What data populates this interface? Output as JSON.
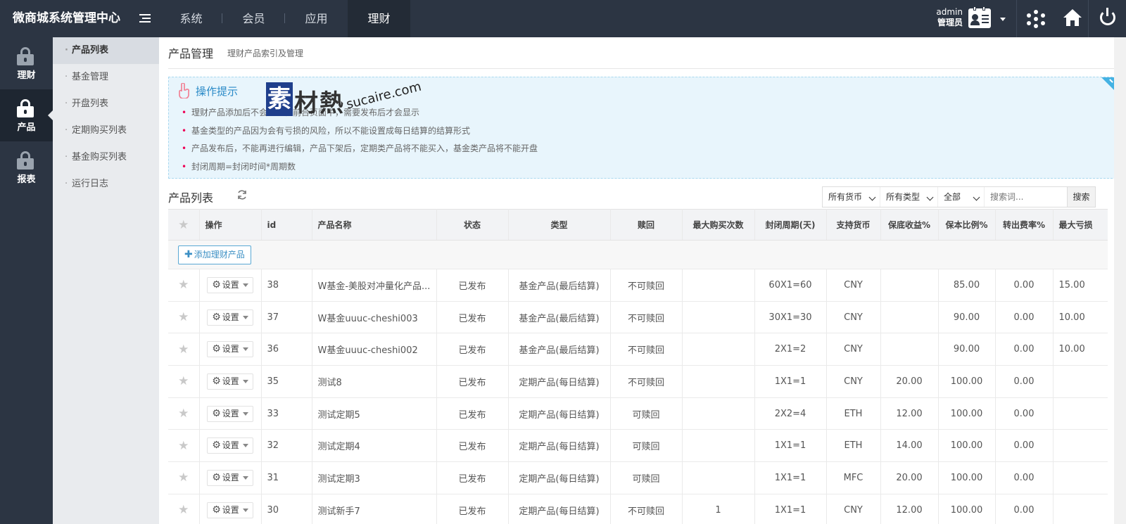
{
  "app": {
    "title": "微商城系统管理中心"
  },
  "topnav": [
    "系统",
    "会员",
    "应用",
    "理财"
  ],
  "user": {
    "name": "admin",
    "role": "管理员"
  },
  "sidebar": [
    {
      "label": "理财"
    },
    {
      "label": "产品"
    },
    {
      "label": "报表"
    }
  ],
  "submenu": [
    "产品列表",
    "基金管理",
    "开盘列表",
    "定期购买列表",
    "基金购买列表",
    "运行日志"
  ],
  "page": {
    "title": "产品管理",
    "subtitle": "理财产品索引及管理"
  },
  "tips": {
    "title": "操作提示",
    "items": [
      "理财产品添加后不会显示在前台页面中，需要发布后才会显示",
      "基金类型的产品因为会有亏损的风险，所以不能设置成每日结算的结算形式",
      "产品发布后，不能再进行编辑，产品下架后，定期类产品将不能买入，基金类产品将不能开盘",
      "封闭周期=封闭时间*周期数"
    ]
  },
  "watermark": {
    "box": "素",
    "text": "材熱",
    "url": "sucaire.com"
  },
  "list": {
    "title": "产品列表",
    "filters": [
      "所有货币",
      "所有类型",
      "全部"
    ],
    "search_placeholder": "搜索词...",
    "search_label": "搜索",
    "add_label": "添加理财产品",
    "set_label": "设置"
  },
  "table": {
    "columns": [
      "操作",
      "id",
      "产品名称",
      "状态",
      "类型",
      "赎回",
      "最大购买次数",
      "封闭周期(天)",
      "支持货币",
      "保底收益%",
      "保本比例%",
      "转出费率%",
      "最大亏损"
    ],
    "rows": [
      [
        "38",
        "W基金-美股对冲量化产品...",
        "已发布",
        "基金产品(最后结算)",
        "不可赎回",
        "",
        "60X1=60",
        "CNY",
        "",
        "85.00",
        "0.00",
        "15.00"
      ],
      [
        "37",
        "W基金uuuc-cheshi003",
        "已发布",
        "基金产品(最后结算)",
        "不可赎回",
        "",
        "30X1=30",
        "CNY",
        "",
        "90.00",
        "0.00",
        "10.00"
      ],
      [
        "36",
        "W基金uuuc-cheshi002",
        "已发布",
        "基金产品(最后结算)",
        "不可赎回",
        "",
        "2X1=2",
        "CNY",
        "",
        "90.00",
        "0.00",
        "10.00"
      ],
      [
        "35",
        "测试8",
        "已发布",
        "定期产品(每日结算)",
        "不可赎回",
        "",
        "1X1=1",
        "CNY",
        "20.00",
        "100.00",
        "0.00",
        ""
      ],
      [
        "33",
        "测试定期5",
        "已发布",
        "定期产品(每日结算)",
        "可赎回",
        "",
        "2X2=4",
        "ETH",
        "12.00",
        "100.00",
        "0.00",
        ""
      ],
      [
        "32",
        "测试定期4",
        "已发布",
        "定期产品(每日结算)",
        "可赎回",
        "",
        "1X1=1",
        "ETH",
        "14.00",
        "100.00",
        "0.00",
        ""
      ],
      [
        "31",
        "测试定期3",
        "已发布",
        "定期产品(每日结算)",
        "可赎回",
        "",
        "1X1=1",
        "MFC",
        "20.00",
        "100.00",
        "0.00",
        ""
      ],
      [
        "30",
        "测试新手7",
        "已发布",
        "定期产品(每日结算)",
        "不可赎回",
        "1",
        "1X1=1",
        "CNY",
        "12.00",
        "100.00",
        "0.00",
        ""
      ]
    ]
  }
}
